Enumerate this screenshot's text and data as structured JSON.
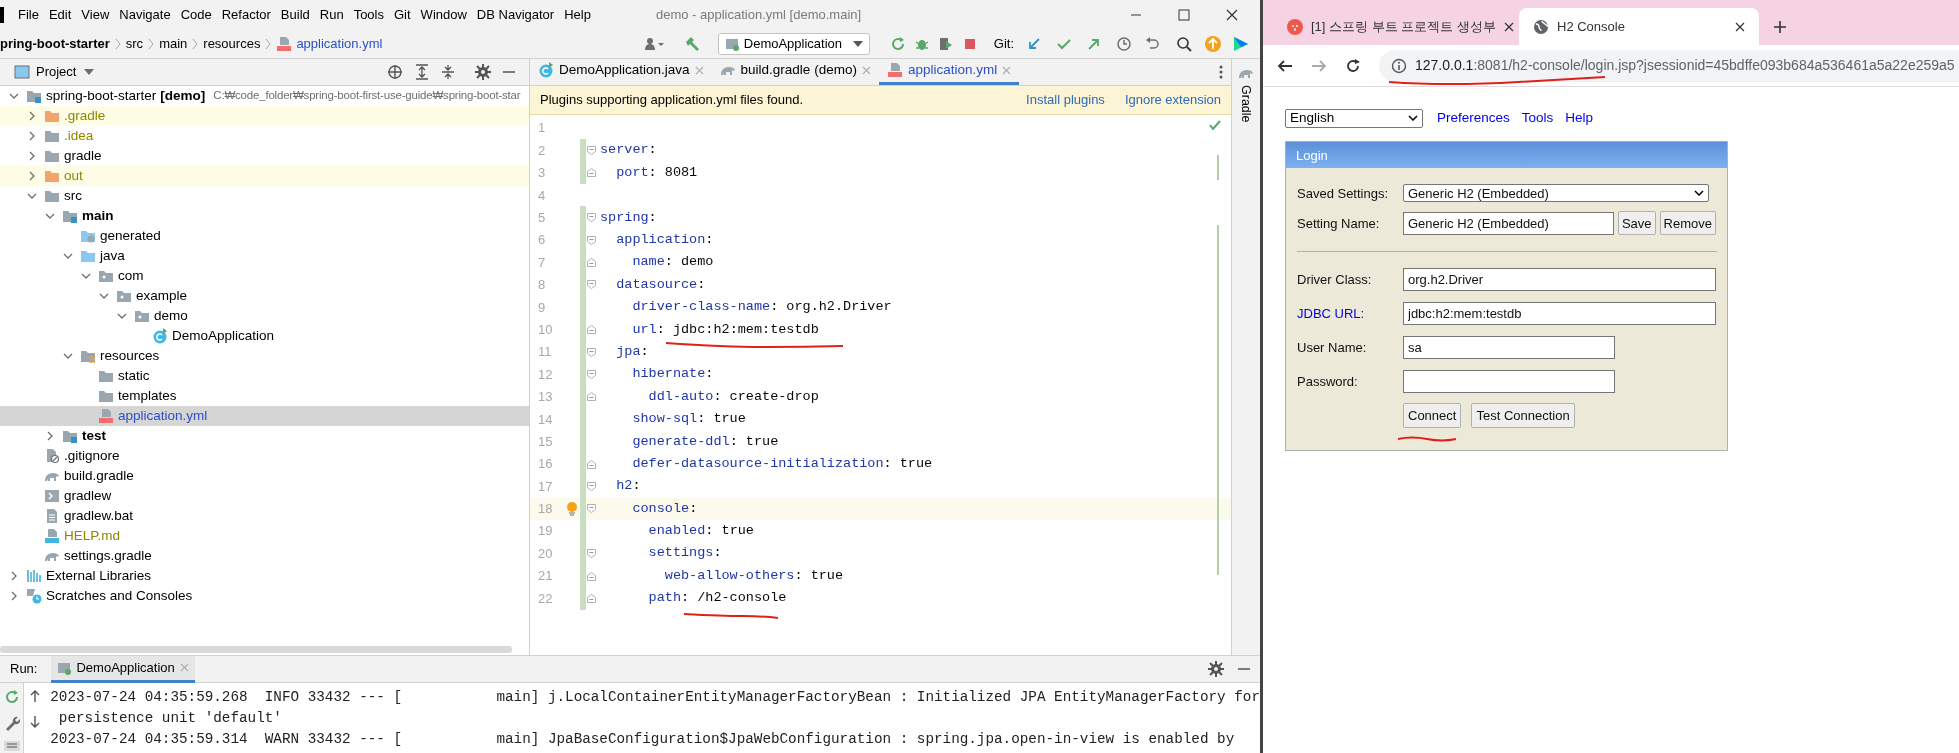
{
  "ide": {
    "window_title": "demo - application.yml [demo.main]",
    "menu": [
      "File",
      "Edit",
      "View",
      "Navigate",
      "Code",
      "Refactor",
      "Build",
      "Run",
      "Tools",
      "Git",
      "Window",
      "DB Navigator",
      "Help"
    ],
    "breadcrumbs": [
      {
        "label": "pring-boot-starter",
        "kind": "project"
      },
      {
        "label": "src",
        "kind": "dir"
      },
      {
        "label": "main",
        "kind": "dir"
      },
      {
        "label": "resources",
        "kind": "dir"
      },
      {
        "label": "application.yml",
        "kind": "yml"
      }
    ],
    "run_config": "DemoApplication",
    "git_label": "Git:",
    "project_panel": {
      "title": "Project",
      "tree": [
        {
          "label": "spring-boot-starter",
          "module": "[demo]",
          "hint": "C:₩code_folder₩spring-boot-first-use-guide₩spring-boot-star",
          "kind": "project",
          "expanded": true,
          "selected": false,
          "children": [
            {
              "label": ".gradle",
              "kind": "excluded",
              "ignored": true,
              "expanded": false,
              "selected": false
            },
            {
              "label": ".idea",
              "kind": "folder",
              "ignored": true,
              "expanded": false,
              "selected": false
            },
            {
              "label": "gradle",
              "kind": "folder",
              "expanded": false,
              "selected": false
            },
            {
              "label": "out",
              "kind": "excluded",
              "ignored": true,
              "expanded": false,
              "selected": false
            },
            {
              "label": "src",
              "kind": "folder",
              "expanded": true,
              "selected": false,
              "children": [
                {
                  "label": "main",
                  "kind": "module",
                  "expanded": true,
                  "selected": false,
                  "children": [
                    {
                      "label": "generated",
                      "kind": "generated",
                      "selected": false
                    },
                    {
                      "label": "java",
                      "kind": "source",
                      "expanded": true,
                      "selected": false,
                      "children": [
                        {
                          "label": "com",
                          "kind": "package",
                          "expanded": true,
                          "selected": false,
                          "children": [
                            {
                              "label": "example",
                              "kind": "package",
                              "expanded": true,
                              "selected": false,
                              "children": [
                                {
                                  "label": "demo",
                                  "kind": "package",
                                  "expanded": true,
                                  "selected": false,
                                  "children": [
                                    {
                                      "label": "DemoApplication",
                                      "kind": "class",
                                      "selected": false
                                    }
                                  ]
                                }
                              ]
                            }
                          ]
                        }
                      ]
                    },
                    {
                      "label": "resources",
                      "kind": "resources",
                      "expanded": true,
                      "selected": false,
                      "children": [
                        {
                          "label": "static",
                          "kind": "folder",
                          "selected": false
                        },
                        {
                          "label": "templates",
                          "kind": "folder",
                          "selected": false
                        },
                        {
                          "label": "application.yml",
                          "kind": "yml",
                          "modified": true,
                          "selected": true
                        }
                      ]
                    }
                  ]
                },
                {
                  "label": "test",
                  "kind": "module",
                  "expanded": false,
                  "selected": false
                }
              ]
            },
            {
              "label": ".gitignore",
              "kind": "gitignore",
              "selected": false
            },
            {
              "label": "build.gradle",
              "kind": "gradle",
              "selected": false
            },
            {
              "label": "gradlew",
              "kind": "script",
              "selected": false
            },
            {
              "label": "gradlew.bat",
              "kind": "bat",
              "selected": false
            },
            {
              "label": "HELP.md",
              "kind": "md",
              "ignored": true,
              "selected": false
            },
            {
              "label": "settings.gradle",
              "kind": "gradle",
              "selected": false
            }
          ]
        },
        {
          "label": "External Libraries",
          "kind": "libraries",
          "expanded": false,
          "selected": false
        },
        {
          "label": "Scratches and Consoles",
          "kind": "scratches",
          "expanded": false,
          "selected": false
        }
      ]
    },
    "editor": {
      "tabs": [
        {
          "label": "DemoApplication.java",
          "kind": "class",
          "selected": false
        },
        {
          "label": "build.gradle (demo)",
          "kind": "gradle",
          "selected": false
        },
        {
          "label": "application.yml",
          "kind": "yml",
          "selected": true
        }
      ],
      "banner": {
        "text": "Plugins supporting application.yml files found.",
        "actions": [
          "Install plugins",
          "Ignore extension"
        ]
      },
      "lines": [
        {
          "number": "1",
          "changed": false
        },
        {
          "number": "2",
          "text": "server:",
          "changed": true,
          "fold_start": true
        },
        {
          "number": "3",
          "text": "  port: 8081",
          "changed": true,
          "fold_end": true
        },
        {
          "number": "4",
          "changed": false
        },
        {
          "number": "5",
          "text": "spring:",
          "changed": true,
          "fold_start": true
        },
        {
          "number": "6",
          "text": "  application:",
          "changed": true,
          "fold_start": true
        },
        {
          "number": "7",
          "text": "    name: demo",
          "changed": true,
          "fold_end": true
        },
        {
          "number": "8",
          "text": "  datasource:",
          "changed": true,
          "fold_start": true
        },
        {
          "number": "9",
          "text": "    driver-class-name: org.h2.Driver",
          "changed": true
        },
        {
          "number": "10",
          "text": "    url: jdbc:h2:mem:testdb",
          "changed": true,
          "fold_end": true
        },
        {
          "number": "11",
          "text": "  jpa:",
          "changed": true,
          "fold_start": true
        },
        {
          "number": "12",
          "text": "    hibernate:",
          "changed": true,
          "fold_start": true
        },
        {
          "number": "13",
          "text": "      ddl-auto: create-drop",
          "changed": true,
          "fold_end": true
        },
        {
          "number": "14",
          "text": "    show-sql: true",
          "changed": true
        },
        {
          "number": "15",
          "text": "    generate-ddl: true",
          "changed": true
        },
        {
          "number": "16",
          "text": "    defer-datasource-initialization: true",
          "changed": true,
          "fold_end": true
        },
        {
          "number": "17",
          "text": "  h2:",
          "changed": true,
          "fold_start": true
        },
        {
          "number": "18",
          "text": "    console:",
          "changed": true,
          "fold_start": true,
          "caret": true
        },
        {
          "number": "19",
          "text": "      enabled: true",
          "changed": true
        },
        {
          "number": "20",
          "text": "      settings:",
          "changed": true,
          "fold_start": true
        },
        {
          "number": "21",
          "text": "        web-allow-others: true",
          "changed": true,
          "fold_end": true
        },
        {
          "number": "22",
          "text": "      path: /h2-console",
          "changed": true,
          "fold_end": true
        }
      ]
    },
    "side_tool": "Gradle",
    "run_panel": {
      "label": "Run:",
      "tab": "DemoApplication",
      "log": [
        "2023-07-24 04:35:59.268  INFO 33432 --- [           main] j.LocalContainerEntityManagerFactoryBean : Initialized JPA EntityManagerFactory for",
        " persistence unit 'default'",
        "2023-07-24 04:35:59.314  WARN 33432 --- [           main] JpaBaseConfiguration$JpaWebConfiguration : spring.jpa.open-in-view is enabled by"
      ]
    }
  },
  "browser": {
    "tabs": [
      {
        "title": "[1] 스프링 부트 프로젝트 생성부",
        "kind": "site",
        "selected": false
      },
      {
        "title": "H2 Console",
        "kind": "globe",
        "selected": true
      }
    ],
    "address": {
      "host": "127.0.0.1",
      "path": ":8081/h2-console/login.jsp?jsessionid=45bdffe093b684a536461a5a22e259a5"
    },
    "page": {
      "language": "English",
      "links": [
        "Preferences",
        "Tools",
        "Help"
      ],
      "login": {
        "title": "Login",
        "saved_settings": {
          "label": "Saved Settings:",
          "value": "Generic H2 (Embedded)"
        },
        "setting_name": {
          "label": "Setting Name:",
          "value": "Generic H2 (Embedded)",
          "buttons": [
            "Save",
            "Remove"
          ]
        },
        "fields": [
          {
            "label": "Driver Class:",
            "value": "org.h2.Driver",
            "link": false
          },
          {
            "label": "JDBC URL:",
            "value": "jdbc:h2:mem:testdb",
            "link": true
          },
          {
            "label": "User Name:",
            "value": "sa",
            "link": false
          },
          {
            "label": "Password:",
            "link": false
          }
        ],
        "buttons": [
          "Connect",
          "Test Connection"
        ]
      }
    }
  }
}
